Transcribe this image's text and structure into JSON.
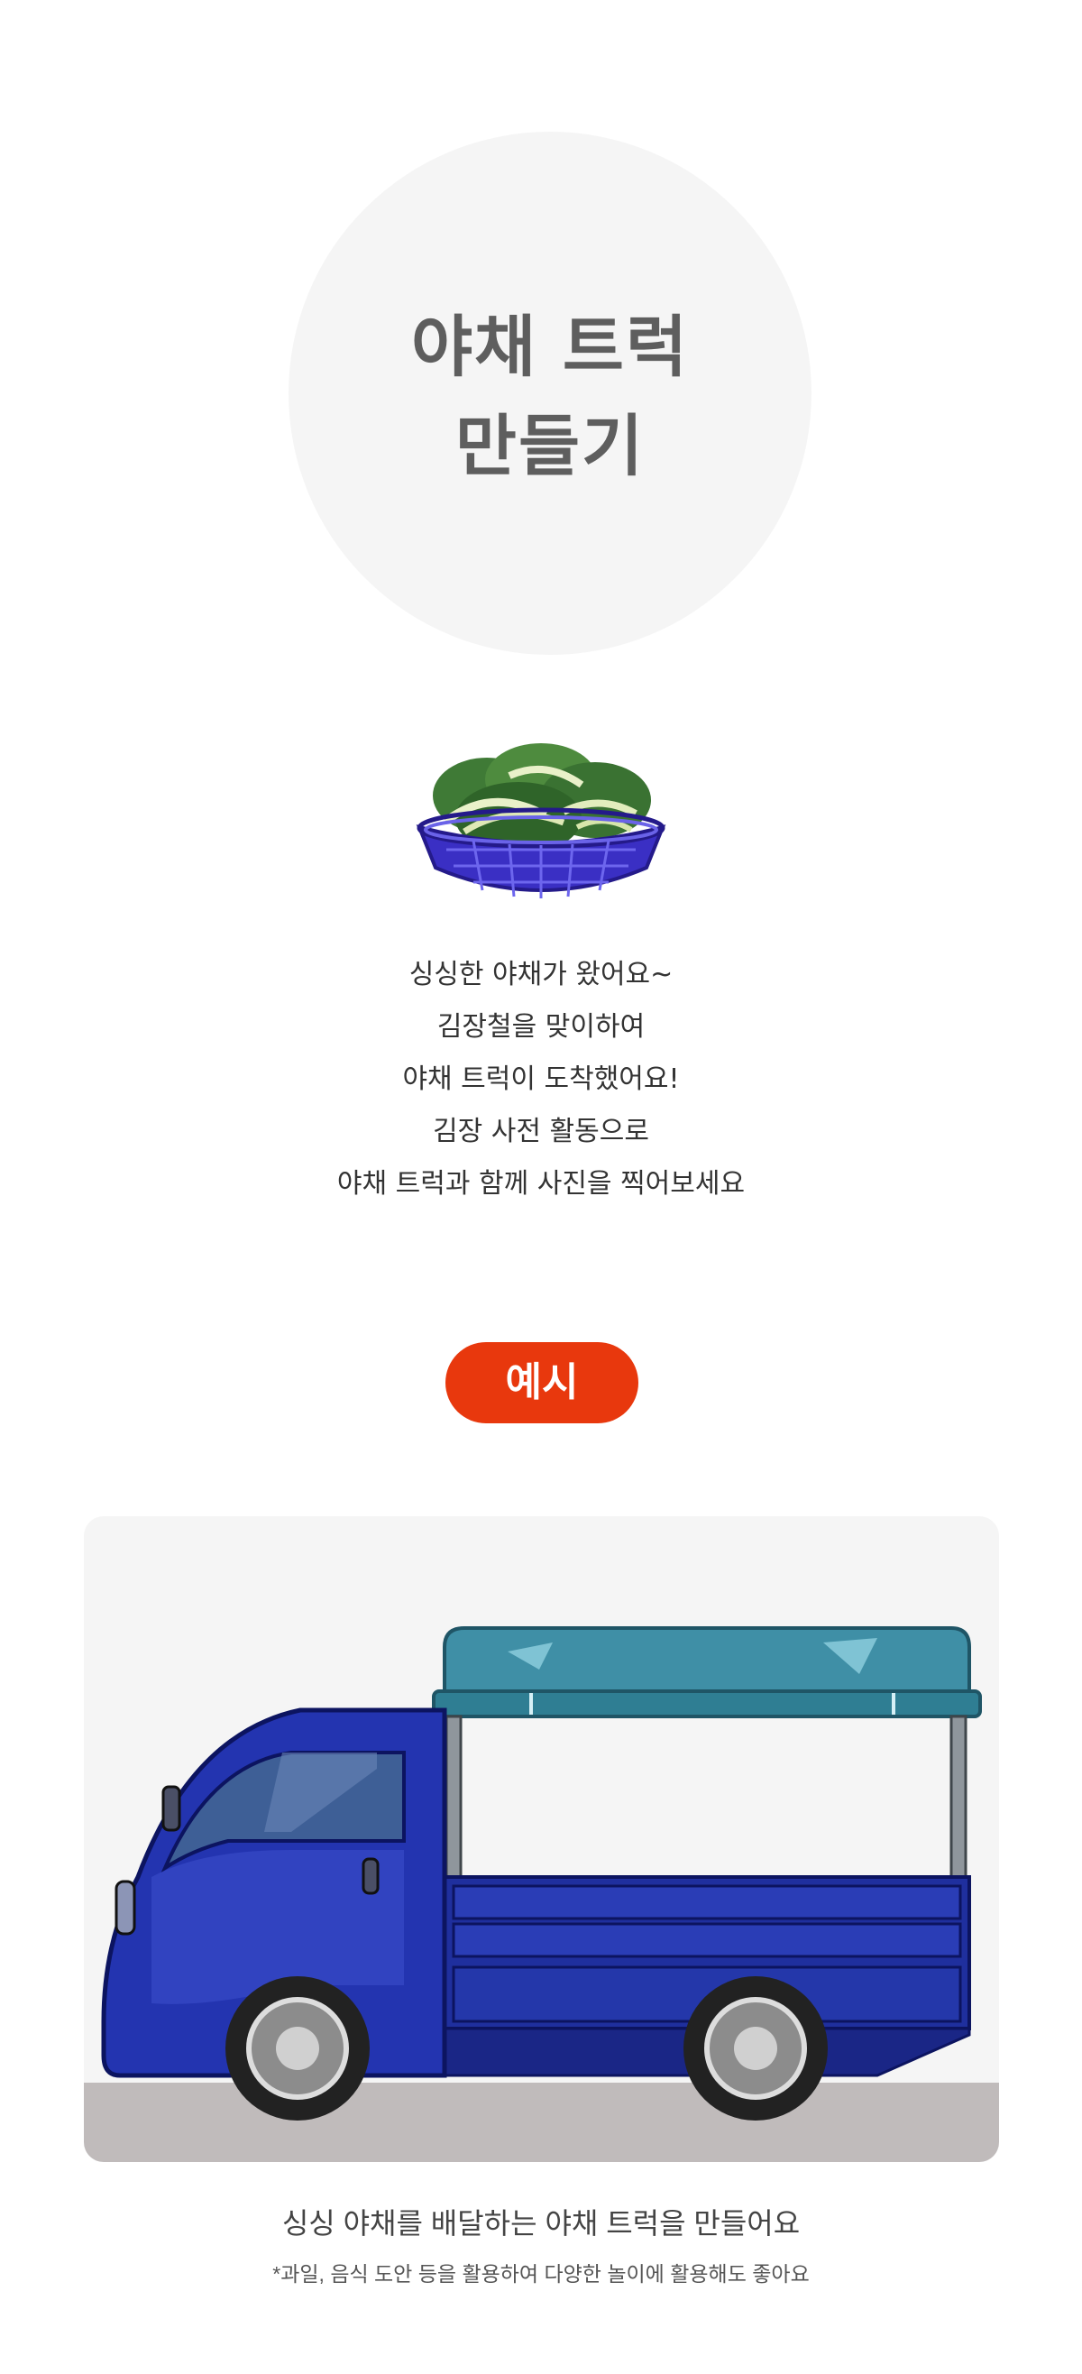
{
  "header": {
    "title_line1": "야채 트럭",
    "title_line2": "만들기"
  },
  "intro_image": {
    "icon": "cabbage-basket-icon"
  },
  "description": {
    "lines": [
      "싱싱한 야채가 왔어요~",
      "김장철을 맞이하여",
      "야채 트럭이 도착했어요!",
      "김장 사전 활동으로",
      "야채 트럭과 함께 사진을 찍어보세요"
    ]
  },
  "example": {
    "badge_label": "예시",
    "badge_color": "#e8380d",
    "image": "blue-vegetable-truck-illustration",
    "caption": "싱싱 야채를 배달하는 야채 트럭을 만들어요",
    "note": "*과일, 음식 도안 등을 활용하여 다양한 놀이에 활용해도 좋아요"
  }
}
